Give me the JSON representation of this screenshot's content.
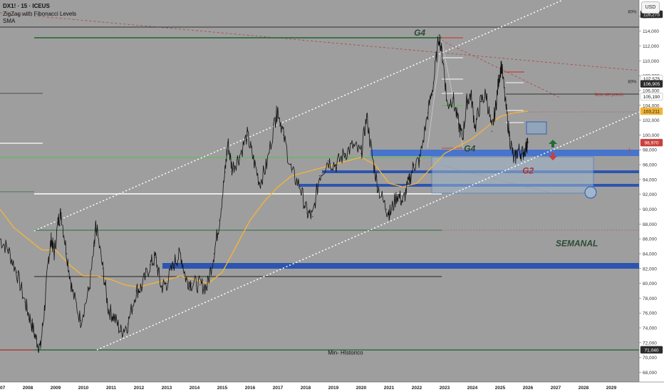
{
  "header": {
    "symbol_line": "DX1! · 15 · ICEUS",
    "indicator_1": "ZigZag with Fibonacci Levels",
    "indicator_2": "SMA",
    "currency_button": "USD"
  },
  "chart_data": {
    "type": "line",
    "title": "DX1! · 15 · ICEUS",
    "x_range": [
      2007.0,
      2030.0
    ],
    "y_range": [
      66.7,
      118.2
    ],
    "y_scale": "linear",
    "x_ticks": [
      {
        "label": "2007",
        "x": 2007.0
      },
      {
        "label": "2008",
        "x": 2008.0
      },
      {
        "label": "2009",
        "x": 2009.0
      },
      {
        "label": "2010",
        "x": 2010.0
      },
      {
        "label": "2011",
        "x": 2011.0
      },
      {
        "label": "2012",
        "x": 2012.0
      },
      {
        "label": "2013",
        "x": 2013.0
      },
      {
        "label": "2014",
        "x": 2014.0
      },
      {
        "label": "2015",
        "x": 2015.0
      },
      {
        "label": "2016",
        "x": 2016.0
      },
      {
        "label": "2017",
        "x": 2017.0
      },
      {
        "label": "2018",
        "x": 2018.0
      },
      {
        "label": "2019",
        "x": 2019.0
      },
      {
        "label": "2020",
        "x": 2020.0
      },
      {
        "label": "2021",
        "x": 2021.0
      },
      {
        "label": "2022",
        "x": 2022.0
      },
      {
        "label": "2023",
        "x": 2023.0
      },
      {
        "label": "2024",
        "x": 2024.0
      },
      {
        "label": "2025",
        "x": 2025.0
      },
      {
        "label": "2026",
        "x": 2026.0
      },
      {
        "label": "2027",
        "x": 2027.0
      },
      {
        "label": "2028",
        "x": 2028.0
      },
      {
        "label": "2029",
        "x": 2029.0
      }
    ],
    "y_ticks": [
      {
        "label": "68,000",
        "y": 68
      },
      {
        "label": "70,000",
        "y": 70
      },
      {
        "label": "72,000",
        "y": 72
      },
      {
        "label": "74,000",
        "y": 74
      },
      {
        "label": "76,000",
        "y": 76
      },
      {
        "label": "78,000",
        "y": 78
      },
      {
        "label": "80,000",
        "y": 80
      },
      {
        "label": "82,000",
        "y": 82
      },
      {
        "label": "84,000",
        "y": 84
      },
      {
        "label": "86,000",
        "y": 86
      },
      {
        "label": "88,000",
        "y": 88
      },
      {
        "label": "90,000",
        "y": 90
      },
      {
        "label": "92,000",
        "y": 92
      },
      {
        "label": "94,000",
        "y": 94
      },
      {
        "label": "96,000",
        "y": 96
      },
      {
        "label": "98,000",
        "y": 98
      },
      {
        "label": "100,000",
        "y": 100
      },
      {
        "label": "102,000",
        "y": 102
      },
      {
        "label": "104,000",
        "y": 104
      },
      {
        "label": "106,000",
        "y": 106
      },
      {
        "label": "108,000",
        "y": 108
      },
      {
        "label": "110,000",
        "y": 110
      },
      {
        "label": "112,000",
        "y": 112
      },
      {
        "label": "114,000",
        "y": 114
      },
      {
        "label": "116,000",
        "y": 116
      }
    ],
    "price_badges": [
      {
        "label": "116,275",
        "y": 116.275,
        "bg": "#2b2b2b",
        "fg": "#ffffff"
      },
      {
        "label": "107,575",
        "y": 107.575,
        "bg": "#ffffff",
        "fg": "#111111"
      },
      {
        "label": "106,905",
        "y": 106.905,
        "bg": "#2b2b2b",
        "fg": "#ffffff"
      },
      {
        "label": "105,190",
        "y": 105.19,
        "bg": "#ffffff",
        "fg": "#111111"
      },
      {
        "label": "103,211",
        "y": 103.211,
        "bg": "#f2b43a",
        "fg": "#111111"
      },
      {
        "label": "98,970",
        "y": 98.97,
        "bg": "#c9403f",
        "fg": "#ffffff"
      },
      {
        "label": "71,040",
        "y": 71.04,
        "bg": "#2b2b2b",
        "fg": "#ffffff"
      }
    ],
    "series": [
      {
        "type": "line",
        "color": "#111111",
        "points": [
          [
            2007.0,
            86.0
          ],
          [
            2007.3,
            84.5
          ],
          [
            2007.6,
            81.5
          ],
          [
            2007.9,
            77.5
          ],
          [
            2008.1,
            75.0
          ],
          [
            2008.3,
            72.5
          ],
          [
            2008.45,
            71.2
          ],
          [
            2008.6,
            76.5
          ],
          [
            2008.75,
            83.5
          ],
          [
            2008.85,
            86.0
          ],
          [
            2008.95,
            84.0
          ],
          [
            2009.1,
            88.5
          ],
          [
            2009.2,
            89.5
          ],
          [
            2009.4,
            84.0
          ],
          [
            2009.6,
            79.0
          ],
          [
            2009.9,
            75.0
          ],
          [
            2010.2,
            79.0
          ],
          [
            2010.4,
            85.0
          ],
          [
            2010.45,
            88.0
          ],
          [
            2010.7,
            82.0
          ],
          [
            2010.9,
            76.5
          ],
          [
            2011.1,
            75.5
          ],
          [
            2011.35,
            73.5
          ],
          [
            2011.6,
            74.5
          ],
          [
            2011.9,
            79.0
          ],
          [
            2012.1,
            79.5
          ],
          [
            2012.4,
            82.5
          ],
          [
            2012.6,
            83.5
          ],
          [
            2012.8,
            79.5
          ],
          [
            2013.0,
            80.0
          ],
          [
            2013.3,
            83.0
          ],
          [
            2013.5,
            84.0
          ],
          [
            2013.7,
            80.5
          ],
          [
            2013.9,
            80.0
          ],
          [
            2014.2,
            79.8
          ],
          [
            2014.45,
            79.5
          ],
          [
            2014.7,
            84.0
          ],
          [
            2014.9,
            88.5
          ],
          [
            2015.1,
            95.0
          ],
          [
            2015.2,
            99.0
          ],
          [
            2015.35,
            95.5
          ],
          [
            2015.6,
            97.0
          ],
          [
            2015.9,
            100.0
          ],
          [
            2016.1,
            97.0
          ],
          [
            2016.35,
            93.5
          ],
          [
            2016.6,
            96.0
          ],
          [
            2016.9,
            102.0
          ],
          [
            2017.0,
            103.5
          ],
          [
            2017.2,
            100.0
          ],
          [
            2017.5,
            95.0
          ],
          [
            2017.8,
            93.0
          ],
          [
            2018.05,
            89.5
          ],
          [
            2018.25,
            89.0
          ],
          [
            2018.5,
            94.5
          ],
          [
            2018.8,
            96.5
          ],
          [
            2019.1,
            96.0
          ],
          [
            2019.4,
            97.5
          ],
          [
            2019.7,
            98.5
          ],
          [
            2020.0,
            97.5
          ],
          [
            2020.2,
            102.5
          ],
          [
            2020.4,
            97.0
          ],
          [
            2020.6,
            93.0
          ],
          [
            2020.9,
            90.0
          ],
          [
            2021.05,
            89.5
          ],
          [
            2021.3,
            92.0
          ],
          [
            2021.5,
            91.0
          ],
          [
            2021.7,
            93.5
          ],
          [
            2021.9,
            96.0
          ],
          [
            2022.1,
            96.5
          ],
          [
            2022.4,
            103.0
          ],
          [
            2022.6,
            107.0
          ],
          [
            2022.8,
            113.5
          ],
          [
            2022.95,
            110.0
          ],
          [
            2023.1,
            104.0
          ],
          [
            2023.3,
            105.0
          ],
          [
            2023.5,
            101.5
          ],
          [
            2023.65,
            99.5
          ],
          [
            2023.8,
            104.5
          ],
          [
            2023.95,
            105.5
          ],
          [
            2024.1,
            101.0
          ],
          [
            2024.3,
            104.5
          ],
          [
            2024.5,
            105.5
          ],
          [
            2024.7,
            100.5
          ],
          [
            2024.85,
            104.0
          ],
          [
            2024.95,
            107.5
          ],
          [
            2025.05,
            109.5
          ],
          [
            2025.2,
            104.0
          ],
          [
            2025.35,
            99.5
          ],
          [
            2025.5,
            96.5
          ],
          [
            2025.65,
            98.0
          ],
          [
            2025.8,
            97.5
          ],
          [
            2025.95,
            98.5
          ],
          [
            2026.0,
            98.97
          ]
        ]
      },
      {
        "type": "line",
        "color": "#f0b43c",
        "points": [
          [
            2007.0,
            90.0
          ],
          [
            2007.5,
            87.5
          ],
          [
            2008.0,
            86.0
          ],
          [
            2008.5,
            84.5
          ],
          [
            2009.0,
            84.5
          ],
          [
            2009.5,
            82.5
          ],
          [
            2010.0,
            81.0
          ],
          [
            2010.5,
            81.0
          ],
          [
            2011.0,
            80.5
          ],
          [
            2011.5,
            79.8
          ],
          [
            2012.0,
            79.5
          ],
          [
            2012.5,
            80.0
          ],
          [
            2013.0,
            80.5
          ],
          [
            2013.5,
            81.0
          ],
          [
            2014.0,
            80.5
          ],
          [
            2014.5,
            80.0
          ],
          [
            2015.0,
            81.5
          ],
          [
            2015.5,
            85.0
          ],
          [
            2016.0,
            88.5
          ],
          [
            2016.5,
            91.0
          ],
          [
            2017.0,
            93.0
          ],
          [
            2017.5,
            94.5
          ],
          [
            2018.0,
            95.0
          ],
          [
            2018.5,
            95.5
          ],
          [
            2019.0,
            96.0
          ],
          [
            2019.5,
            96.5
          ],
          [
            2020.0,
            97.0
          ],
          [
            2020.5,
            96.0
          ],
          [
            2021.0,
            93.5
          ],
          [
            2021.5,
            93.0
          ],
          [
            2022.0,
            93.5
          ],
          [
            2022.5,
            95.5
          ],
          [
            2023.0,
            97.5
          ],
          [
            2023.5,
            98.5
          ],
          [
            2024.0,
            99.5
          ],
          [
            2024.5,
            101.0
          ],
          [
            2025.0,
            102.5
          ],
          [
            2025.5,
            103.0
          ],
          [
            2026.0,
            103.2
          ]
        ]
      }
    ],
    "annotations": [
      {
        "text": "G4",
        "x": 2021.9,
        "y": 113.4,
        "color": "#2b4a33",
        "size": 12
      },
      {
        "text": "G4",
        "x": 2023.7,
        "y": 97.8,
        "color": "#2b4a33",
        "size": 12
      },
      {
        "text": "G2",
        "x": 2025.8,
        "y": 94.8,
        "color": "#b03030",
        "size": 12
      },
      {
        "text": "SEMANAL",
        "x": 2027.0,
        "y": 85.0,
        "color": "#2b4a33",
        "size": 12
      },
      {
        "text": "Min- HIstorico",
        "x": 2018.8,
        "y": 70.4,
        "color": "#111111",
        "size": 8
      },
      {
        "text": "falso del precio",
        "x": 2028.4,
        "y": 105.3,
        "color": "#b03030",
        "size": 6
      },
      {
        "text": "80%",
        "x": 2029.6,
        "y": 116.4,
        "color": "#222222",
        "size": 6
      },
      {
        "text": "80%",
        "x": 2029.6,
        "y": 107.0,
        "color": "#222222",
        "size": 6
      }
    ],
    "grid": false,
    "legend": "none"
  }
}
